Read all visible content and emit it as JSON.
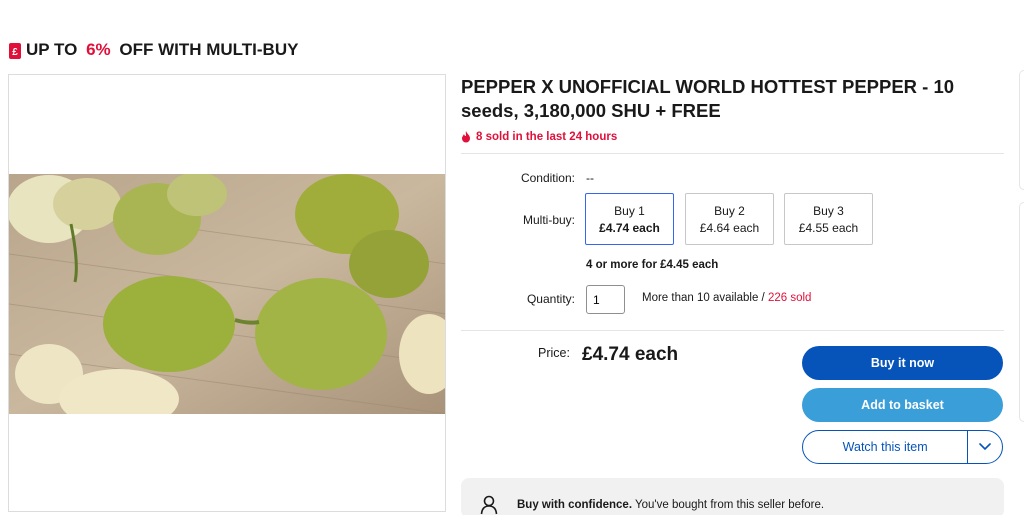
{
  "promo": {
    "prefix": "UP TO ",
    "percent": "6%",
    "suffix": " OFF WITH MULTI-BUY"
  },
  "listing": {
    "title": "PEPPER X UNOFFICIAL WORLD HOTTEST PEPPER - 10 seeds, 3,180,000 SHU + FREE",
    "sold_recent": "8 sold in the last 24 hours"
  },
  "condition": {
    "label": "Condition:",
    "value": "--"
  },
  "multibuy": {
    "label": "Multi-buy:",
    "options": [
      {
        "qty": "Buy 1",
        "price": "£4.74 each",
        "selected": true
      },
      {
        "qty": "Buy 2",
        "price": "£4.64 each",
        "selected": false
      },
      {
        "qty": "Buy 3",
        "price": "£4.55 each",
        "selected": false
      }
    ],
    "four_more": "4 or more for £4.45 each"
  },
  "quantity": {
    "label": "Quantity:",
    "value": "1",
    "available": "More than 10 available",
    "separator": " / ",
    "sold": "226 sold"
  },
  "price": {
    "label": "Price:",
    "value": "£4.74 each"
  },
  "buttons": {
    "buy_now": "Buy it now",
    "add_basket": "Add to basket",
    "watch": "Watch this item"
  },
  "confidence": {
    "bold": "Buy with confidence.",
    "text": " You've bought from this seller before."
  },
  "colors": {
    "accent_red": "#e0103a",
    "buy_blue": "#0654ba",
    "basket_blue": "#3a9ed9",
    "selected_border": "#3665f3"
  },
  "icons": {
    "promo": "price-tag-icon",
    "fire": "fire-icon",
    "watch_dropdown": "chevron-down-icon",
    "confidence": "person-icon"
  }
}
